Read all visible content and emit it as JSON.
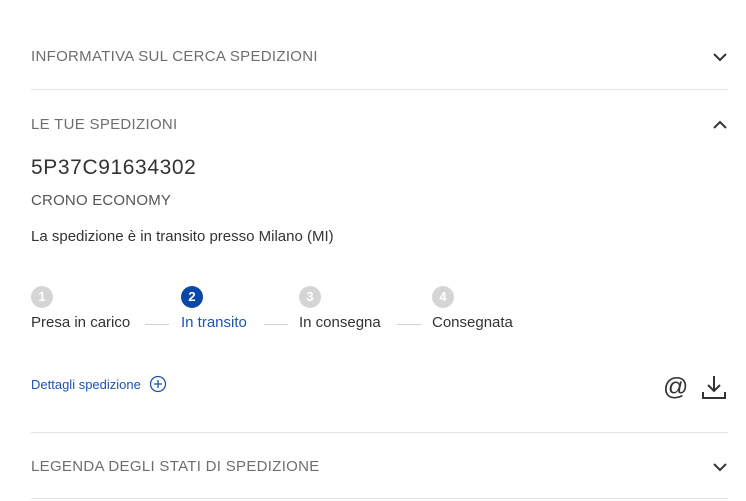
{
  "sections": {
    "info": {
      "title": "INFORMATIVA SUL CERCA SPEDIZIONI",
      "icon": "chevron-down-icon"
    },
    "shipments": {
      "title": "LE TUE SPEDIZIONI",
      "icon": "chevron-up-icon"
    },
    "legend": {
      "title": "LEGENDA DEGLI STATI DI SPEDIZIONE",
      "icon": "chevron-down-icon"
    }
  },
  "shipment": {
    "code": "5P37C91634302",
    "service": "CRONO ECONOMY",
    "status_text": "La spedizione è in transito presso Milano (MI)"
  },
  "steps": [
    {
      "number": "1",
      "label": "Presa in carico"
    },
    {
      "number": "2",
      "label": "In transito"
    },
    {
      "number": "3",
      "label": "In consegna"
    },
    {
      "number": "4",
      "label": "Consegnata"
    }
  ],
  "current_step": 2,
  "details": {
    "label": "Dettagli spedizione",
    "icon": "plus-circle-icon"
  },
  "actions": {
    "email_symbol": "@",
    "download_icon": "download-icon"
  },
  "colors": {
    "accent": "#0a47a9",
    "link": "#1d54b0",
    "inactive_step": "#d5d5d5"
  }
}
